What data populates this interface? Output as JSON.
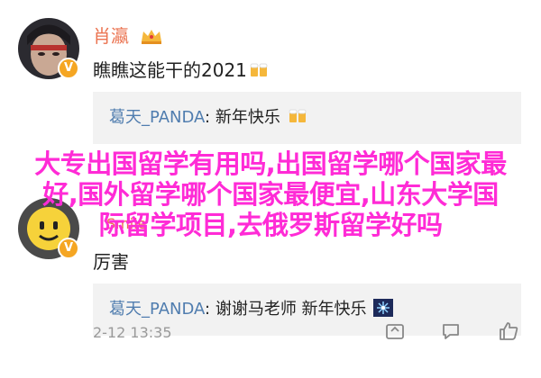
{
  "comment1": {
    "username": "肖瀛",
    "text": "瞧瞧这能干的2021",
    "emoji": "beer-cheers-emoji",
    "badge": "crown-badge-icon",
    "reply": {
      "user": "葛天_PANDA",
      "text": ": 新年快乐",
      "emoji": "beer-cheers-emoji"
    }
  },
  "comment2": {
    "username_fragment": "Smile",
    "text": "厉害",
    "reply": {
      "user": "葛天_PANDA",
      "text": ": 谢谢马老师 新年快乐",
      "emoji": "fireworks-emoji"
    }
  },
  "footer": {
    "timestamp": "2-12 13:35",
    "icons": [
      "repost-icon",
      "comment-icon",
      "like-icon"
    ]
  },
  "overlay": {
    "lines": [
      "大专出国留学有用吗,出国留学哪个国家最",
      "好,国外留学哪个国家最便宜,山东大学国",
      "际留学项目,去俄罗斯留学好吗"
    ]
  },
  "colors": {
    "username": "#eb7350",
    "reply_user": "#507daf",
    "reply_bg": "#f2f2f2",
    "overlay_text": "#ff2bd6",
    "verify_badge": "#f5a623"
  }
}
